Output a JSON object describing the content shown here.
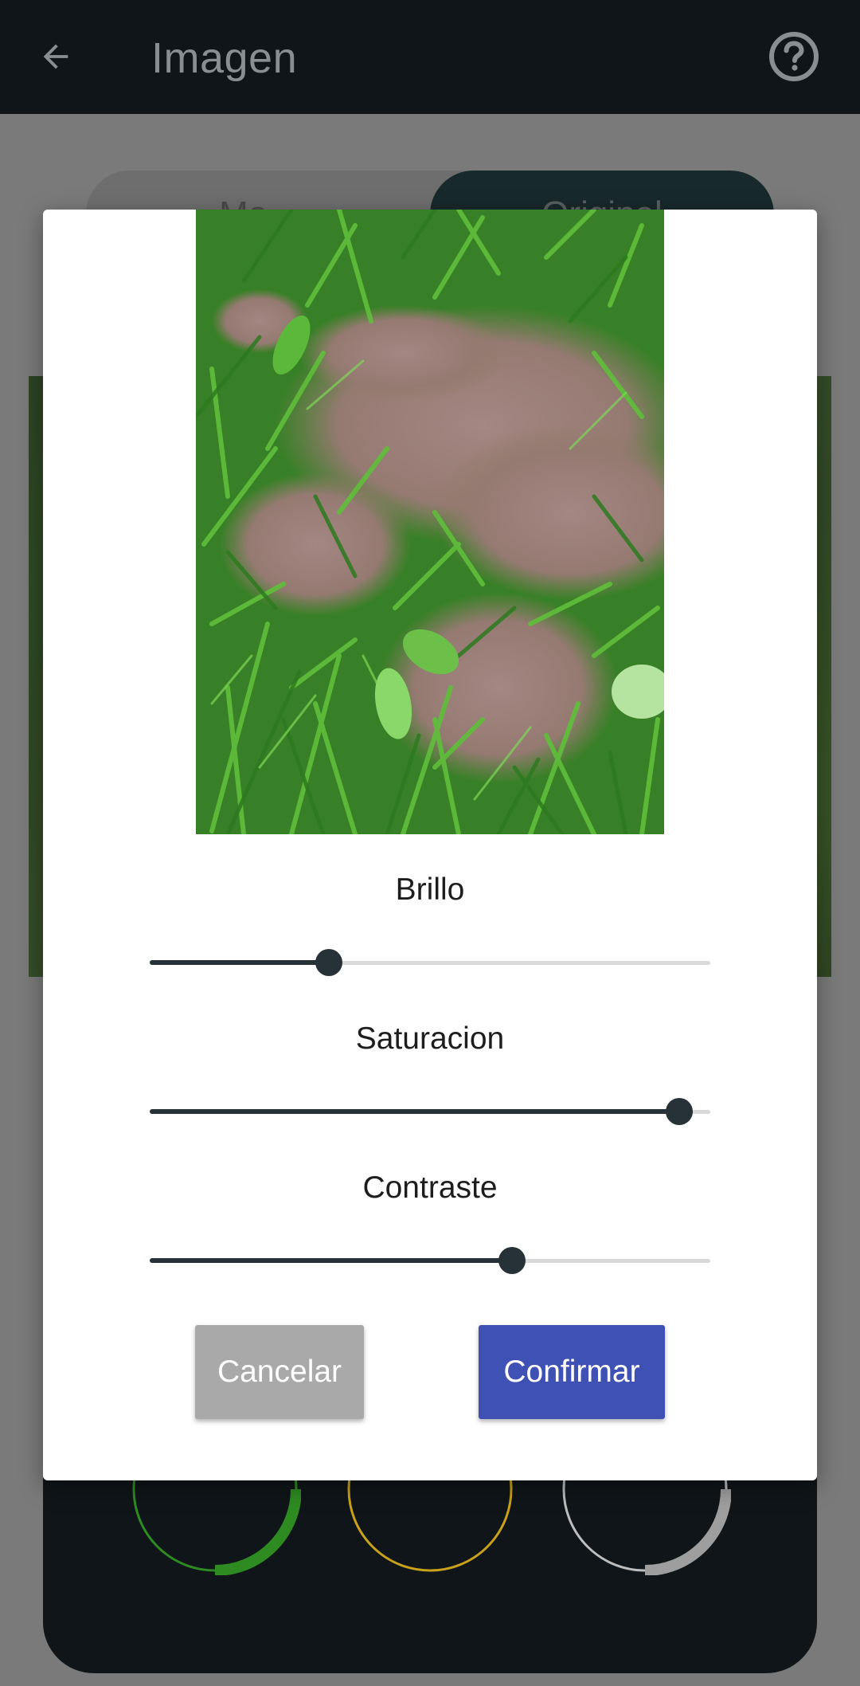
{
  "app_bar": {
    "title": "Imagen",
    "back_icon": "arrow-back-icon",
    "help_icon": "help-circle-icon"
  },
  "background": {
    "toggle_left_label": "Ma...",
    "toggle_right_label": "Original",
    "gauge_colors": [
      "#2e8b22",
      "#c9a21a",
      "#9e9e9e"
    ]
  },
  "dialog": {
    "sliders": [
      {
        "label": "Brillo",
        "value": 0.32
      },
      {
        "label": "Saturacion",
        "value": 0.945
      },
      {
        "label": "Contraste",
        "value": 0.647
      }
    ],
    "cancel_label": "Cancelar",
    "confirm_label": "Confirmar"
  },
  "colors": {
    "appbar": "#0f1518",
    "slider_active": "#263238",
    "confirm_button": "#3f51b5",
    "cancel_button": "#a9a9a9"
  }
}
